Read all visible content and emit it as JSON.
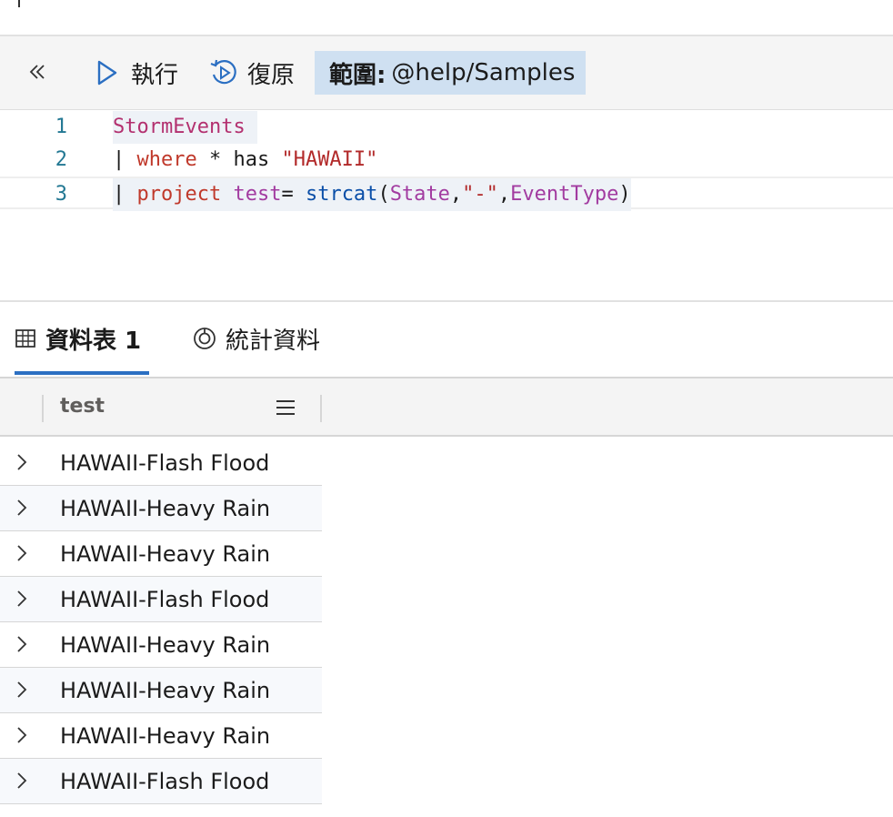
{
  "toolbar": {
    "run_label": "執行",
    "recall_label": "復原",
    "scope_label": "範圍:",
    "scope_value": "@help/Samples"
  },
  "editor": {
    "line_numbers": [
      "1",
      "2",
      "3"
    ],
    "line1": {
      "table": "StormEvents"
    },
    "line2": {
      "pipe": "| ",
      "op": "where",
      "mid": " * has ",
      "str": "\"HAWAII\""
    },
    "line3": {
      "pipe": "| ",
      "op": "project",
      "space": " ",
      "col": "test",
      "eq": "= ",
      "fn": "strcat",
      "open": "(",
      "arg1": "State",
      "comma1": ",",
      "arg2": "\"-\"",
      "comma2": ",",
      "arg3": "EventType",
      "close": ")"
    }
  },
  "tabs": [
    {
      "label": "資料表 1",
      "icon": "table-icon",
      "active": true
    },
    {
      "label": "統計資料",
      "icon": "stats-icon",
      "active": false
    }
  ],
  "grid": {
    "column_header": "test",
    "rows": [
      "HAWAII-Flash Flood",
      "HAWAII-Heavy Rain",
      "HAWAII-Heavy Rain",
      "HAWAII-Flash Flood",
      "HAWAII-Heavy Rain",
      "HAWAII-Heavy Rain",
      "HAWAII-Heavy Rain",
      "HAWAII-Flash Flood"
    ]
  },
  "colors": {
    "accent": "#2b6fc2",
    "scope_bg": "#cfe0f1",
    "toolbar_bg": "#f5f5f5"
  }
}
